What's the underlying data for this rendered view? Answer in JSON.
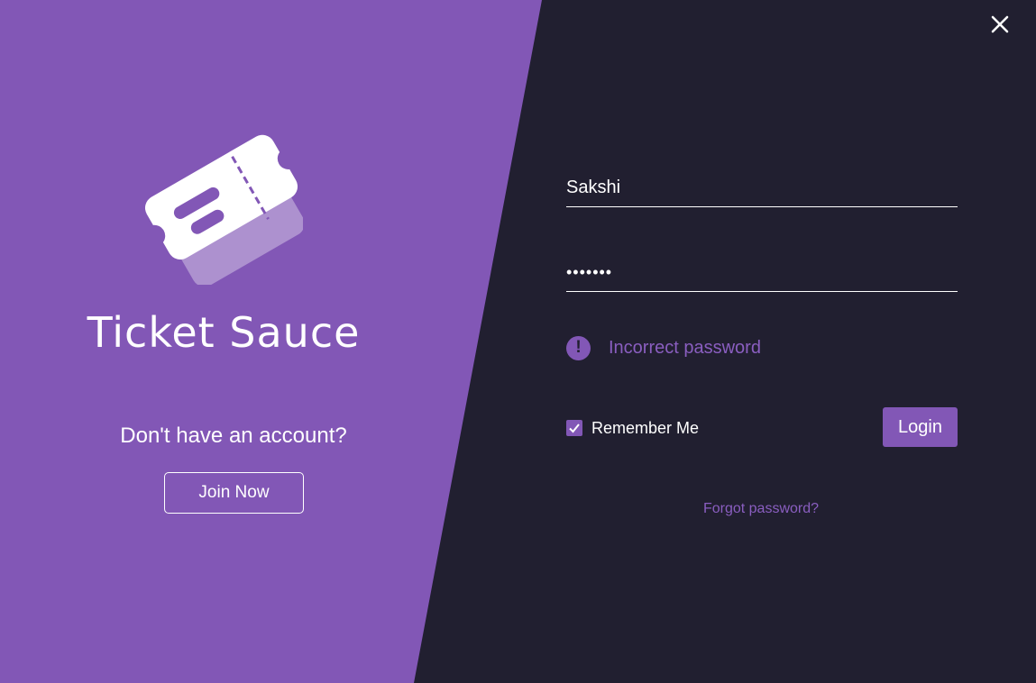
{
  "brand": {
    "title": "Ticket Sauce",
    "logo_icon": "ticket-icon"
  },
  "signup": {
    "prompt": "Don't have an account?",
    "button_label": "Join Now"
  },
  "window": {
    "close_icon": "close-icon"
  },
  "login_form": {
    "username_value": "Sakshi",
    "password_value": "•••••••",
    "error_icon": "exclamation-icon",
    "error_text": "Incorrect password",
    "remember_label": "Remember Me",
    "remember_checked": true,
    "login_label": "Login",
    "forgot_label": "Forgot password?"
  },
  "colors": {
    "accent": "#8257b6",
    "background_dark": "#211f30",
    "text_light": "#ffffff"
  }
}
